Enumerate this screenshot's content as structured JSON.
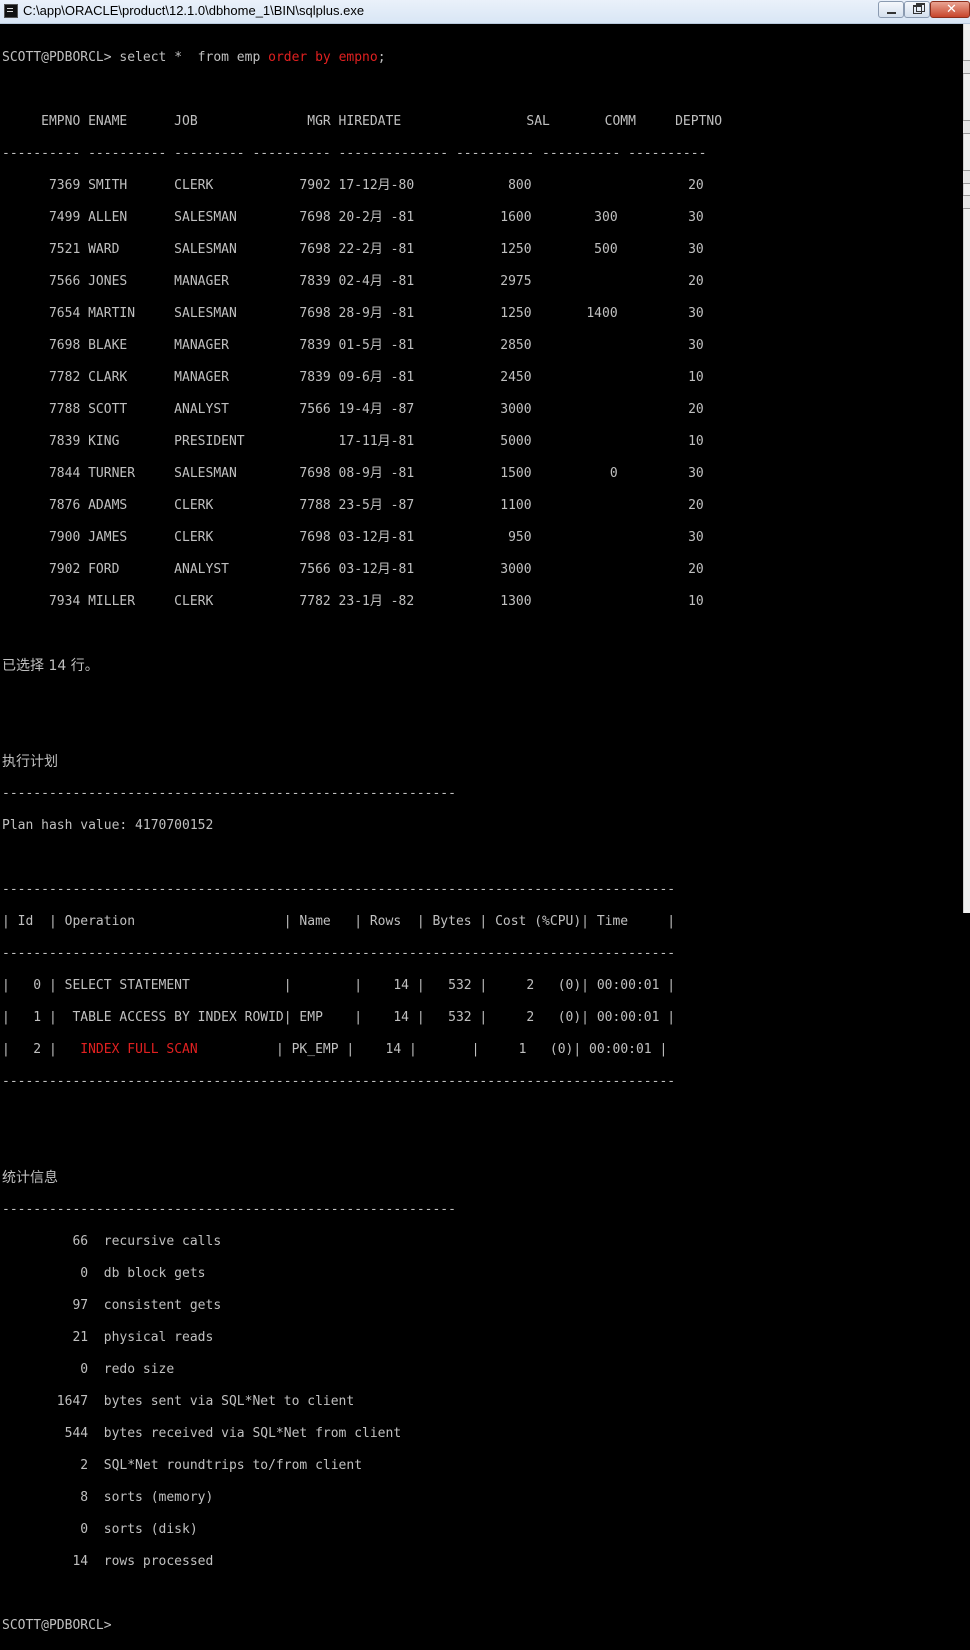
{
  "window": {
    "title": "C:\\app\\ORACLE\\product\\12.1.0\\dbhome_1\\BIN\\sqlplus.exe",
    "close_glyph": "✕"
  },
  "console": {
    "prompt": "SCOTT@PDBORCL> ",
    "command_plain": "select *  from emp ",
    "command_red": "order by empno",
    "command_end": ";",
    "table_header": "     EMPNO ENAME      JOB              MGR HIREDATE                SAL       COMM     DEPTNO",
    "table_sep": "---------- ---------- --------- ---------- -------------- ---------- ---------- ----------",
    "rows": [
      "      7369 SMITH      CLERK           7902 17-12月-80            800                    20",
      "      7499 ALLEN      SALESMAN        7698 20-2月 -81           1600        300         30",
      "      7521 WARD       SALESMAN        7698 22-2月 -81           1250        500         30",
      "      7566 JONES      MANAGER         7839 02-4月 -81           2975                    20",
      "      7654 MARTIN     SALESMAN        7698 28-9月 -81           1250       1400         30",
      "      7698 BLAKE      MANAGER         7839 01-5月 -81           2850                    30",
      "      7782 CLARK      MANAGER         7839 09-6月 -81           2450                    10",
      "      7788 SCOTT      ANALYST         7566 19-4月 -87           3000                    20",
      "      7839 KING       PRESIDENT            17-11月-81           5000                    10",
      "      7844 TURNER     SALESMAN        7698 08-9月 -81           1500          0         30",
      "      7876 ADAMS      CLERK           7788 23-5月 -87           1100                    20",
      "      7900 JAMES      CLERK           7698 03-12月-81            950                    30",
      "      7902 FORD       ANALYST         7566 03-12月-81           3000                    20",
      "      7934 MILLER     CLERK           7782 23-1月 -82           1300                    10"
    ],
    "rows_selected": "已选择 14 行。",
    "plan_title": "执行计划",
    "plan_rule": "----------------------------------------------------------",
    "plan_hash": "Plan hash value: 4170700152",
    "plan_border": "--------------------------------------------------------------------------------------",
    "plan_header": "| Id  | Operation                   | Name   | Rows  | Bytes | Cost (%CPU)| Time     |",
    "plan_rows": [
      "|   0 | SELECT STATEMENT            |        |    14 |   532 |     2   (0)| 00:00:01 |",
      "|   1 |  TABLE ACCESS BY INDEX ROWID| EMP    |    14 |   532 |     2   (0)| 00:00:01 |"
    ],
    "plan_row2": {
      "pre": "|   2 |   ",
      "red": "INDEX FULL SCAN",
      "post": "          | PK_EMP |    14 |       |     1   (0)| 00:00:01 |"
    },
    "stats_title": "统计信息",
    "stats_rule": "----------------------------------------------------------",
    "stats": [
      "         66  recursive calls",
      "          0  db block gets",
      "         97  consistent gets",
      "         21  physical reads",
      "          0  redo size",
      "       1647  bytes sent via SQL*Net to client",
      "        544  bytes received via SQL*Net from client",
      "          2  SQL*Net roundtrips to/from client",
      "          8  sorts (memory)",
      "          0  sorts (disk)",
      "         14  rows processed"
    ],
    "final_prompt": "SCOTT@PDBORCL>"
  }
}
